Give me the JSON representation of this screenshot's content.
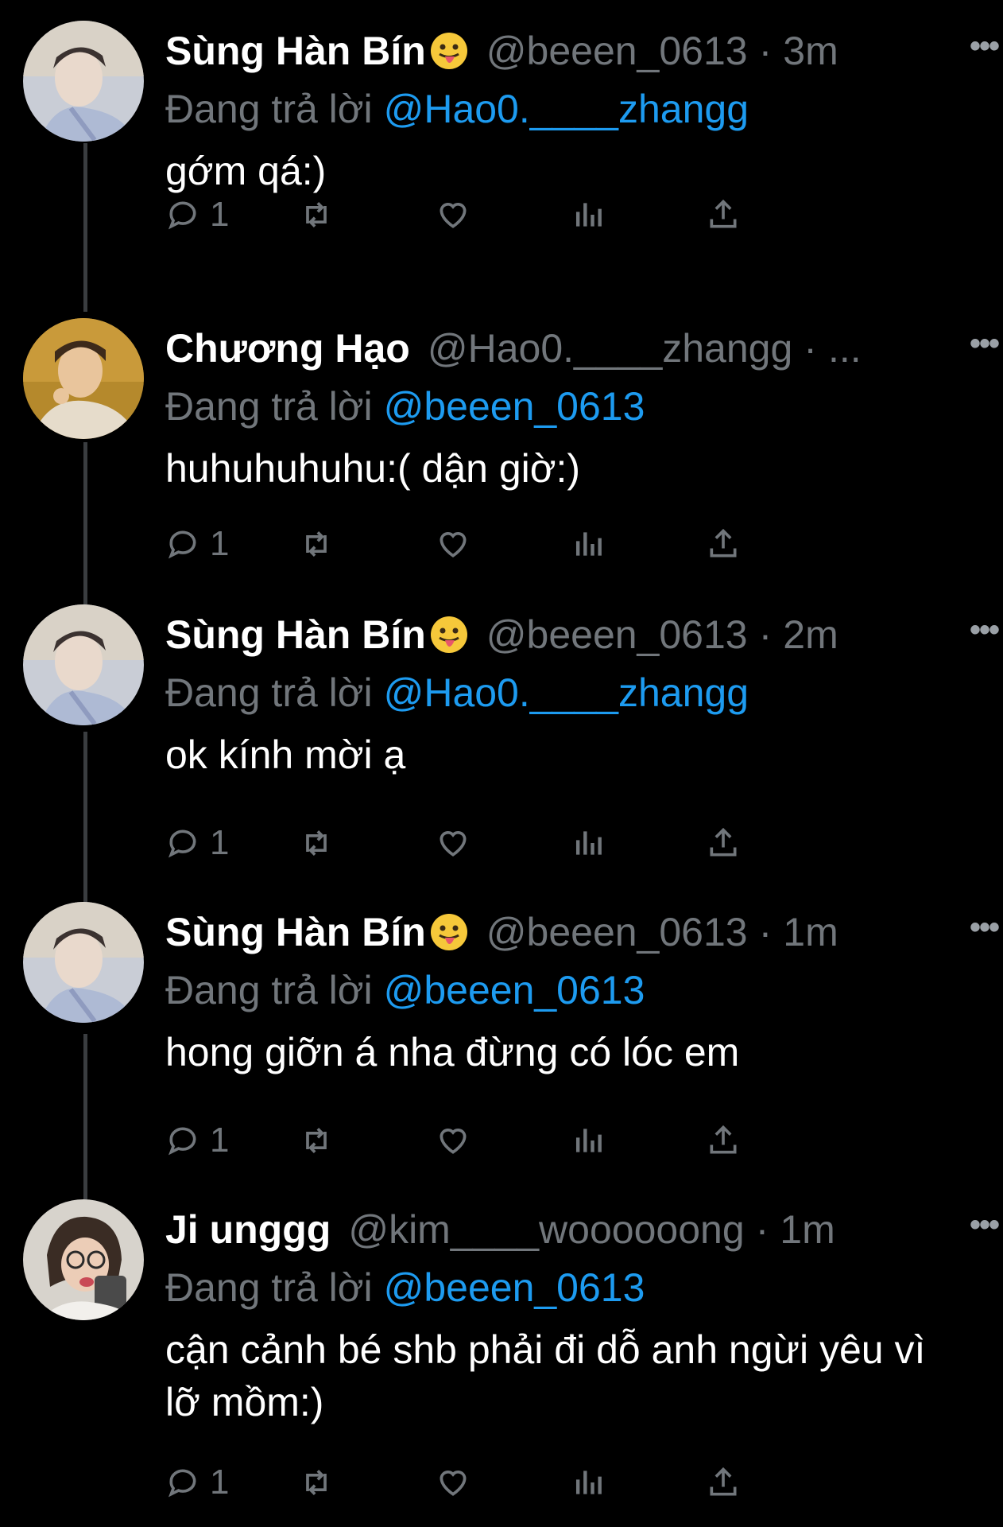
{
  "reply_prefix": "Đang trả lời",
  "tweets": [
    {
      "name": "Sùng Hàn Bín",
      "emoji": "tongue-out-face",
      "handle": "@beeen_0613",
      "separator": "·",
      "time": "3m",
      "reply_to": "@Hao0.____zhangg",
      "text": "gớm qá:)",
      "reply_count": "1"
    },
    {
      "name": "Chương Hạo",
      "emoji": "",
      "handle": "@Hao0.____zhangg",
      "separator": "·",
      "time": "...",
      "reply_to": "@beeen_0613",
      "text": "huhuhuhuhu:( dận giờ:)",
      "reply_count": "1"
    },
    {
      "name": "Sùng Hàn Bín",
      "emoji": "tongue-out-face",
      "handle": "@beeen_0613",
      "separator": "·",
      "time": "2m",
      "reply_to": "@Hao0.____zhangg",
      "text": "ok kính mời ạ",
      "reply_count": "1"
    },
    {
      "name": "Sùng Hàn Bín",
      "emoji": "tongue-out-face",
      "handle": "@beeen_0613",
      "separator": "·",
      "time": "1m",
      "reply_to": "@beeen_0613",
      "text": "hong giỡn á nha đừng có lóc em",
      "reply_count": "1"
    },
    {
      "name": "Ji unggg",
      "emoji": "",
      "handle": "@kim____woooooong",
      "separator": "·",
      "time": "1m",
      "reply_to": "@beeen_0613",
      "text": "cận cảnh bé shb phải đi dỗ anh ngừi yêu vì lỡ mồm:)",
      "reply_count": "1"
    }
  ],
  "more_label": "•••",
  "colors": {
    "background": "#000000",
    "text": "#ffffff",
    "muted": "#71767b",
    "mention": "#1d9bf0",
    "thread_line": "#3a3d40"
  }
}
